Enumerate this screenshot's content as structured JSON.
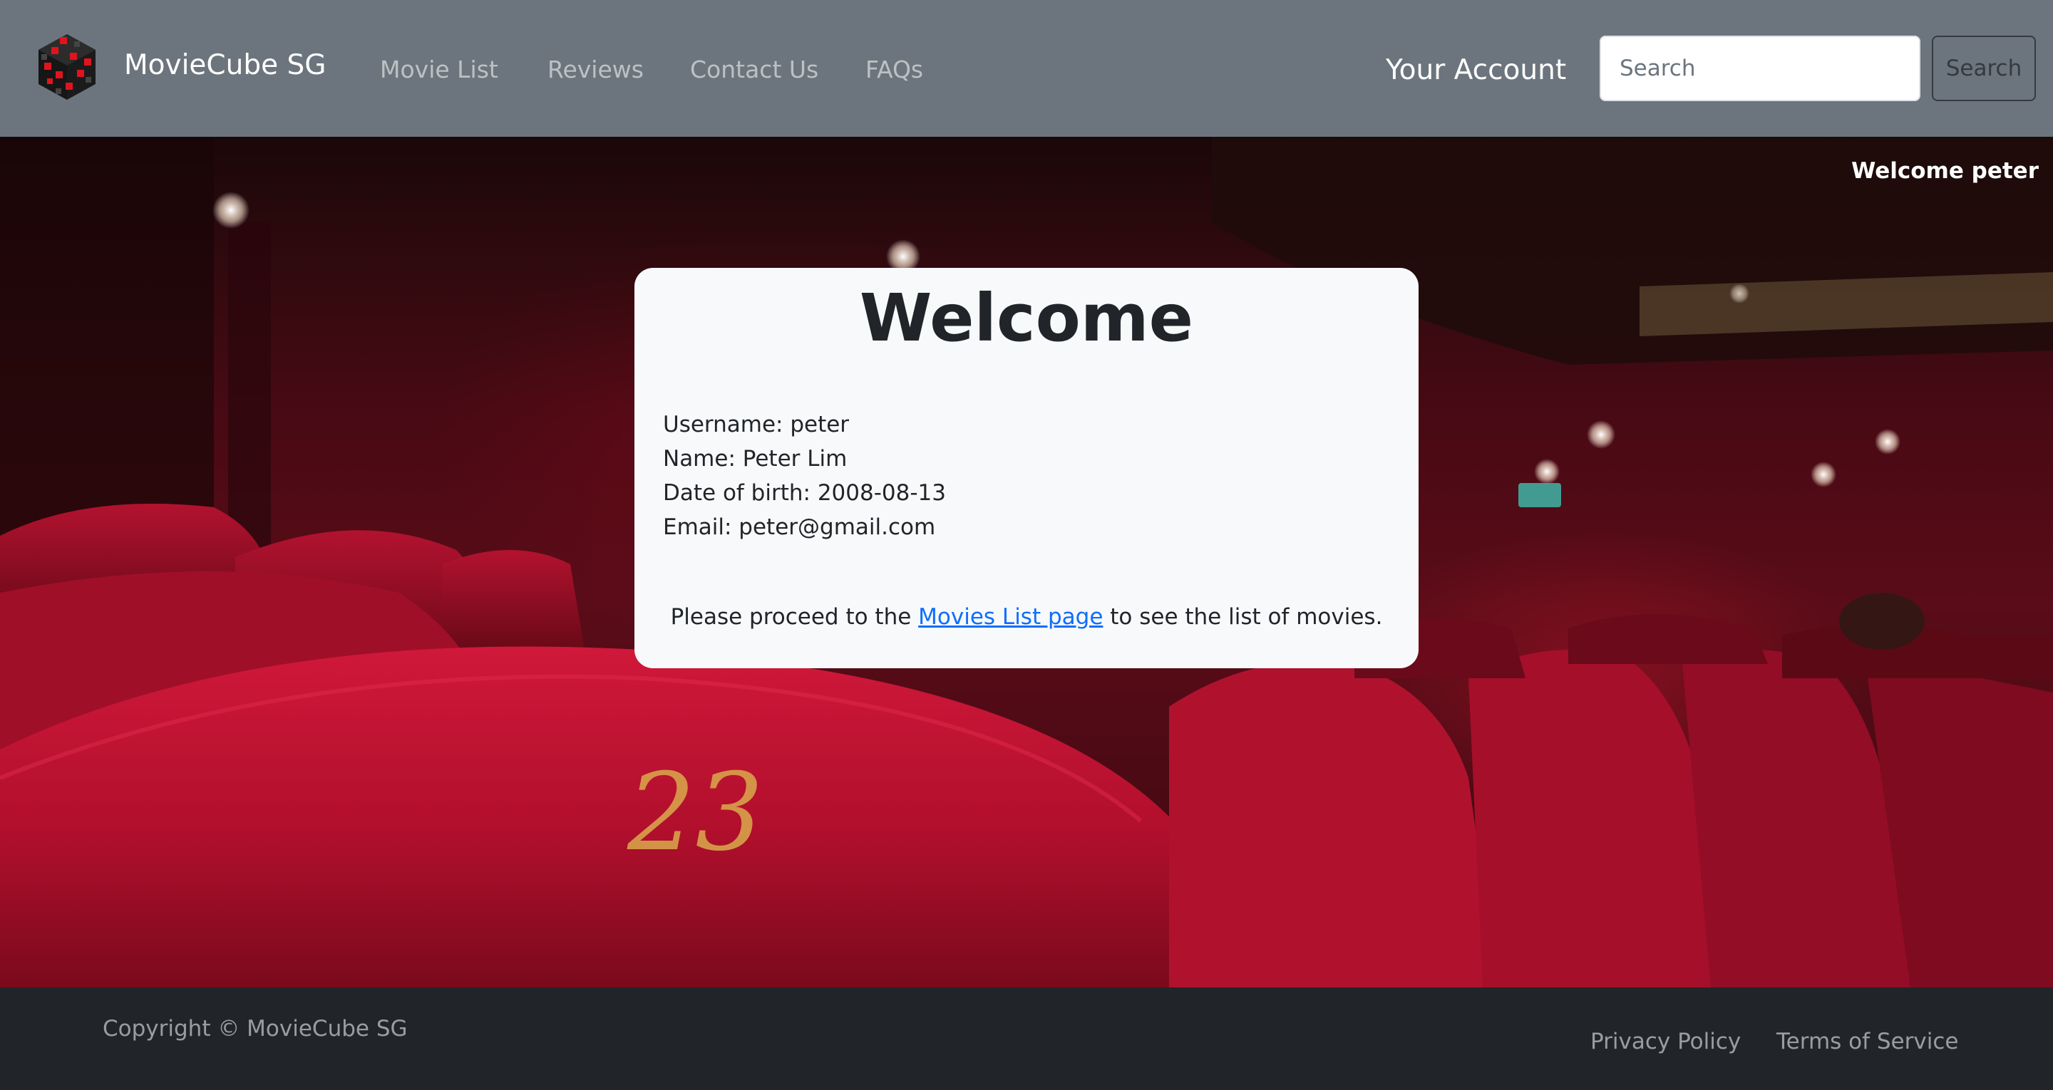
{
  "navbar": {
    "brand": "MovieCube SG",
    "links": [
      "Movie List",
      "Reviews",
      "Contact Us",
      "FAQs"
    ],
    "account_label": "Your Account",
    "search_placeholder": "Search",
    "search_button": "Search"
  },
  "hero": {
    "welcome_user": "Welcome peter",
    "seat_number": "23"
  },
  "card": {
    "title": "Welcome",
    "username": "Username: peter",
    "name": "Name: Peter Lim",
    "dob": "Date of birth: 2008-08-13",
    "email": "Email: peter@gmail.com",
    "proceed_before": "Please proceed to the ",
    "proceed_link": "Movies List page",
    "proceed_after": " to see the list of movies."
  },
  "footer": {
    "copyright": "Copyright © MovieCube SG",
    "links": [
      "Privacy Policy",
      "Terms of Service"
    ]
  },
  "colors": {
    "navbar_bg": "#6c757d",
    "footer_bg": "#212529",
    "card_bg": "#f8f9fa",
    "link": "#0d6efd",
    "seat_red": "#c8102e"
  },
  "icons": [
    "cube-logo-icon"
  ]
}
